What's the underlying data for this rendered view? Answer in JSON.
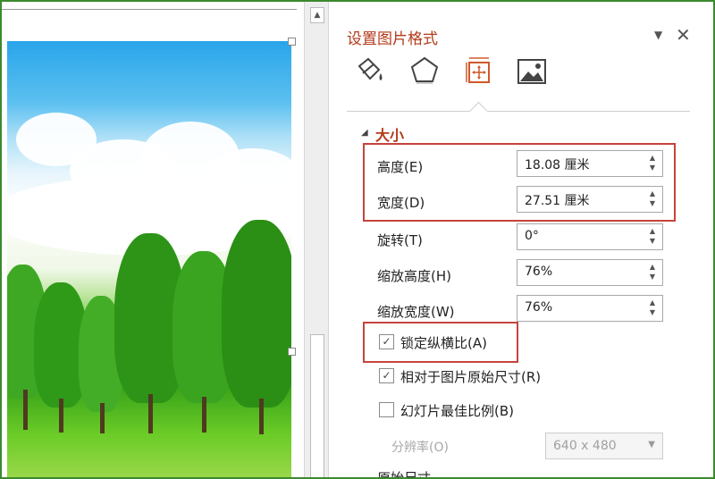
{
  "pane": {
    "title": "设置图片格式",
    "tabs": [
      {
        "name": "fill-line",
        "icon": "paint-bucket-icon"
      },
      {
        "name": "effects",
        "icon": "pentagon-icon"
      },
      {
        "name": "size-properties",
        "icon": "size-position-icon"
      },
      {
        "name": "picture",
        "icon": "picture-icon"
      }
    ]
  },
  "size_section": {
    "title": "大小",
    "height_label": "高度(E)",
    "height_value": "18.08 厘米",
    "width_label": "宽度(D)",
    "width_value": "27.51 厘米",
    "rotation_label": "旋转(T)",
    "rotation_value": "0°",
    "scale_height_label": "缩放高度(H)",
    "scale_height_value": "76%",
    "scale_width_label": "缩放宽度(W)",
    "scale_width_value": "76%",
    "lock_aspect_label": "锁定纵横比(A)",
    "lock_aspect_checked": true,
    "relative_original_label": "相对于图片原始尺寸(R)",
    "relative_original_checked": true,
    "best_scale_label": "幻灯片最佳比例(B)",
    "best_scale_checked": false,
    "resolution_label": "分辨率(O)",
    "resolution_value": "640 x 480",
    "original_size_label": "原始尺寸"
  },
  "colors": {
    "accent": "#b33a1a",
    "highlight": "#c5443c",
    "frame": "#3a8a2e"
  }
}
